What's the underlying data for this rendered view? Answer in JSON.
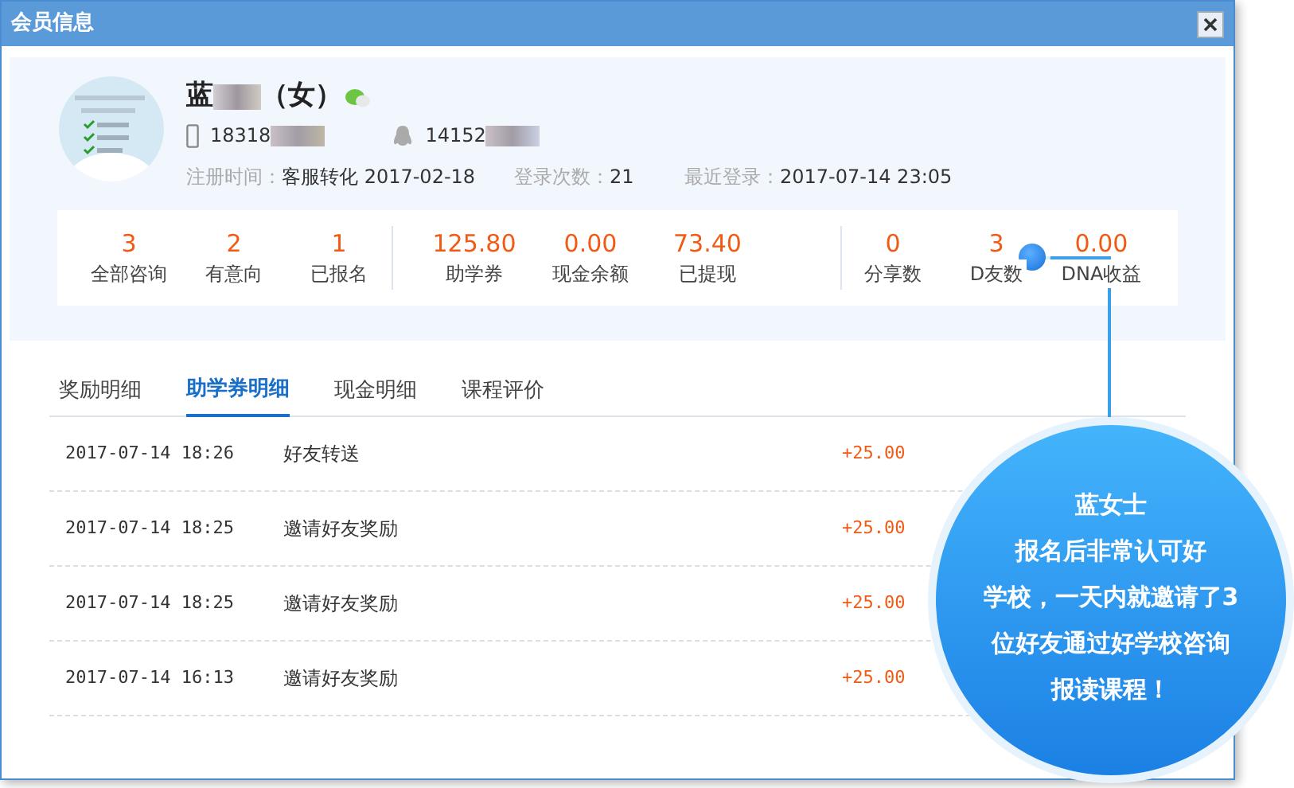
{
  "window": {
    "title": "会员信息"
  },
  "member": {
    "name_visible": "蓝",
    "gender": "（女）",
    "phone": "18318",
    "qq": "14152",
    "register_label": "注册时间：",
    "register_value": "客服转化 2017-02-18",
    "logins_label": "登录次数：",
    "logins_value": "21",
    "last_login_label": "最近登录：",
    "last_login_value": "2017-07-14 23:05"
  },
  "stats": [
    [
      {
        "value": "3",
        "label": "全部咨询"
      },
      {
        "value": "2",
        "label": "有意向"
      },
      {
        "value": "1",
        "label": "已报名"
      }
    ],
    [
      {
        "value": "125.80",
        "label": "助学券"
      },
      {
        "value": "0.00",
        "label": "现金余额"
      },
      {
        "value": "73.40",
        "label": "已提现"
      }
    ],
    [
      {
        "value": "0",
        "label": "分享数"
      },
      {
        "value": "3",
        "label": "D友数"
      },
      {
        "value": "0.00",
        "label": "DNA收益"
      }
    ]
  ],
  "tabs": [
    {
      "label": "奖励明细",
      "selected": false
    },
    {
      "label": "助学券明细",
      "selected": true
    },
    {
      "label": "现金明细",
      "selected": false
    },
    {
      "label": "课程评价",
      "selected": false
    }
  ],
  "rows": [
    {
      "time": "2017-07-14 18:26",
      "reason": "好友转送",
      "amount": "+25.00"
    },
    {
      "time": "2017-07-14 18:25",
      "reason": "邀请好友奖励",
      "amount": "+25.00"
    },
    {
      "time": "2017-07-14 18:25",
      "reason": "邀请好友奖励",
      "amount": "+25.00"
    },
    {
      "time": "2017-07-14 16:13",
      "reason": "邀请好友奖励",
      "amount": "+25.00"
    }
  ],
  "callout": {
    "lines": [
      "蓝女士",
      "报名后非常认可好",
      "学校，一天内就邀请了3",
      "位好友通过好学校咨询",
      "报读课程！"
    ]
  }
}
